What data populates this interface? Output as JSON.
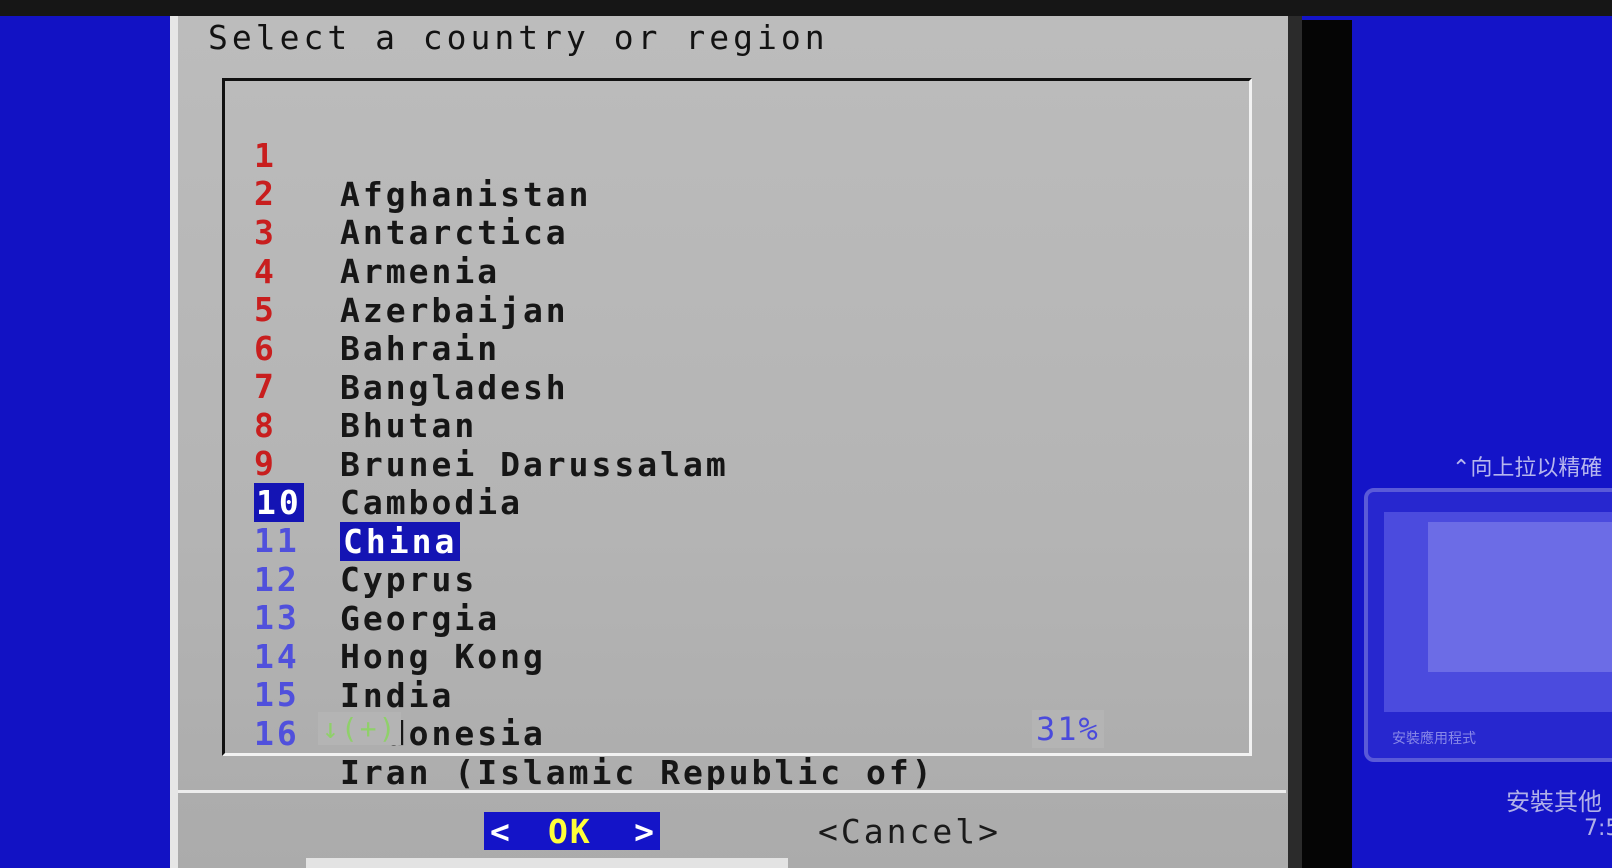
{
  "dialog": {
    "title": "Select a country or region",
    "items": [
      {
        "num": "1",
        "name": "Afghanistan"
      },
      {
        "num": "2",
        "name": "Antarctica"
      },
      {
        "num": "3",
        "name": "Armenia"
      },
      {
        "num": "4",
        "name": "Azerbaijan"
      },
      {
        "num": "5",
        "name": "Bahrain"
      },
      {
        "num": "6",
        "name": "Bangladesh"
      },
      {
        "num": "7",
        "name": "Bhutan"
      },
      {
        "num": "8",
        "name": "Brunei Darussalam"
      },
      {
        "num": "9",
        "name": "Cambodia"
      },
      {
        "num": "10",
        "name": "China",
        "selected": true
      },
      {
        "num": "11",
        "name": "Cyprus"
      },
      {
        "num": "12",
        "name": "Georgia"
      },
      {
        "num": "13",
        "name": "Hong Kong"
      },
      {
        "num": "14",
        "name": "India"
      },
      {
        "num": "15",
        "name": "Indonesia"
      },
      {
        "num": "16",
        "name": "Iran (Islamic Republic of)"
      }
    ],
    "scroll_hint": "↓(+)",
    "scroll_percent": "31%",
    "ok_label": "OK",
    "ok_left": "<",
    "ok_right": ">",
    "cancel_label": "<Cancel>"
  },
  "side_panel": {
    "hint": "⌃向上拉以精確",
    "thumbnail_label": "安裝應用程式",
    "install_text": "安裝其他",
    "time_text": "7:5"
  },
  "colors": {
    "desktop_blue": "#1414c8",
    "dialog_gray": "#b4b4b4",
    "selection_blue": "#1414b4",
    "number_red": "#c81e1e",
    "highlight_yellow": "#ffff3a"
  }
}
